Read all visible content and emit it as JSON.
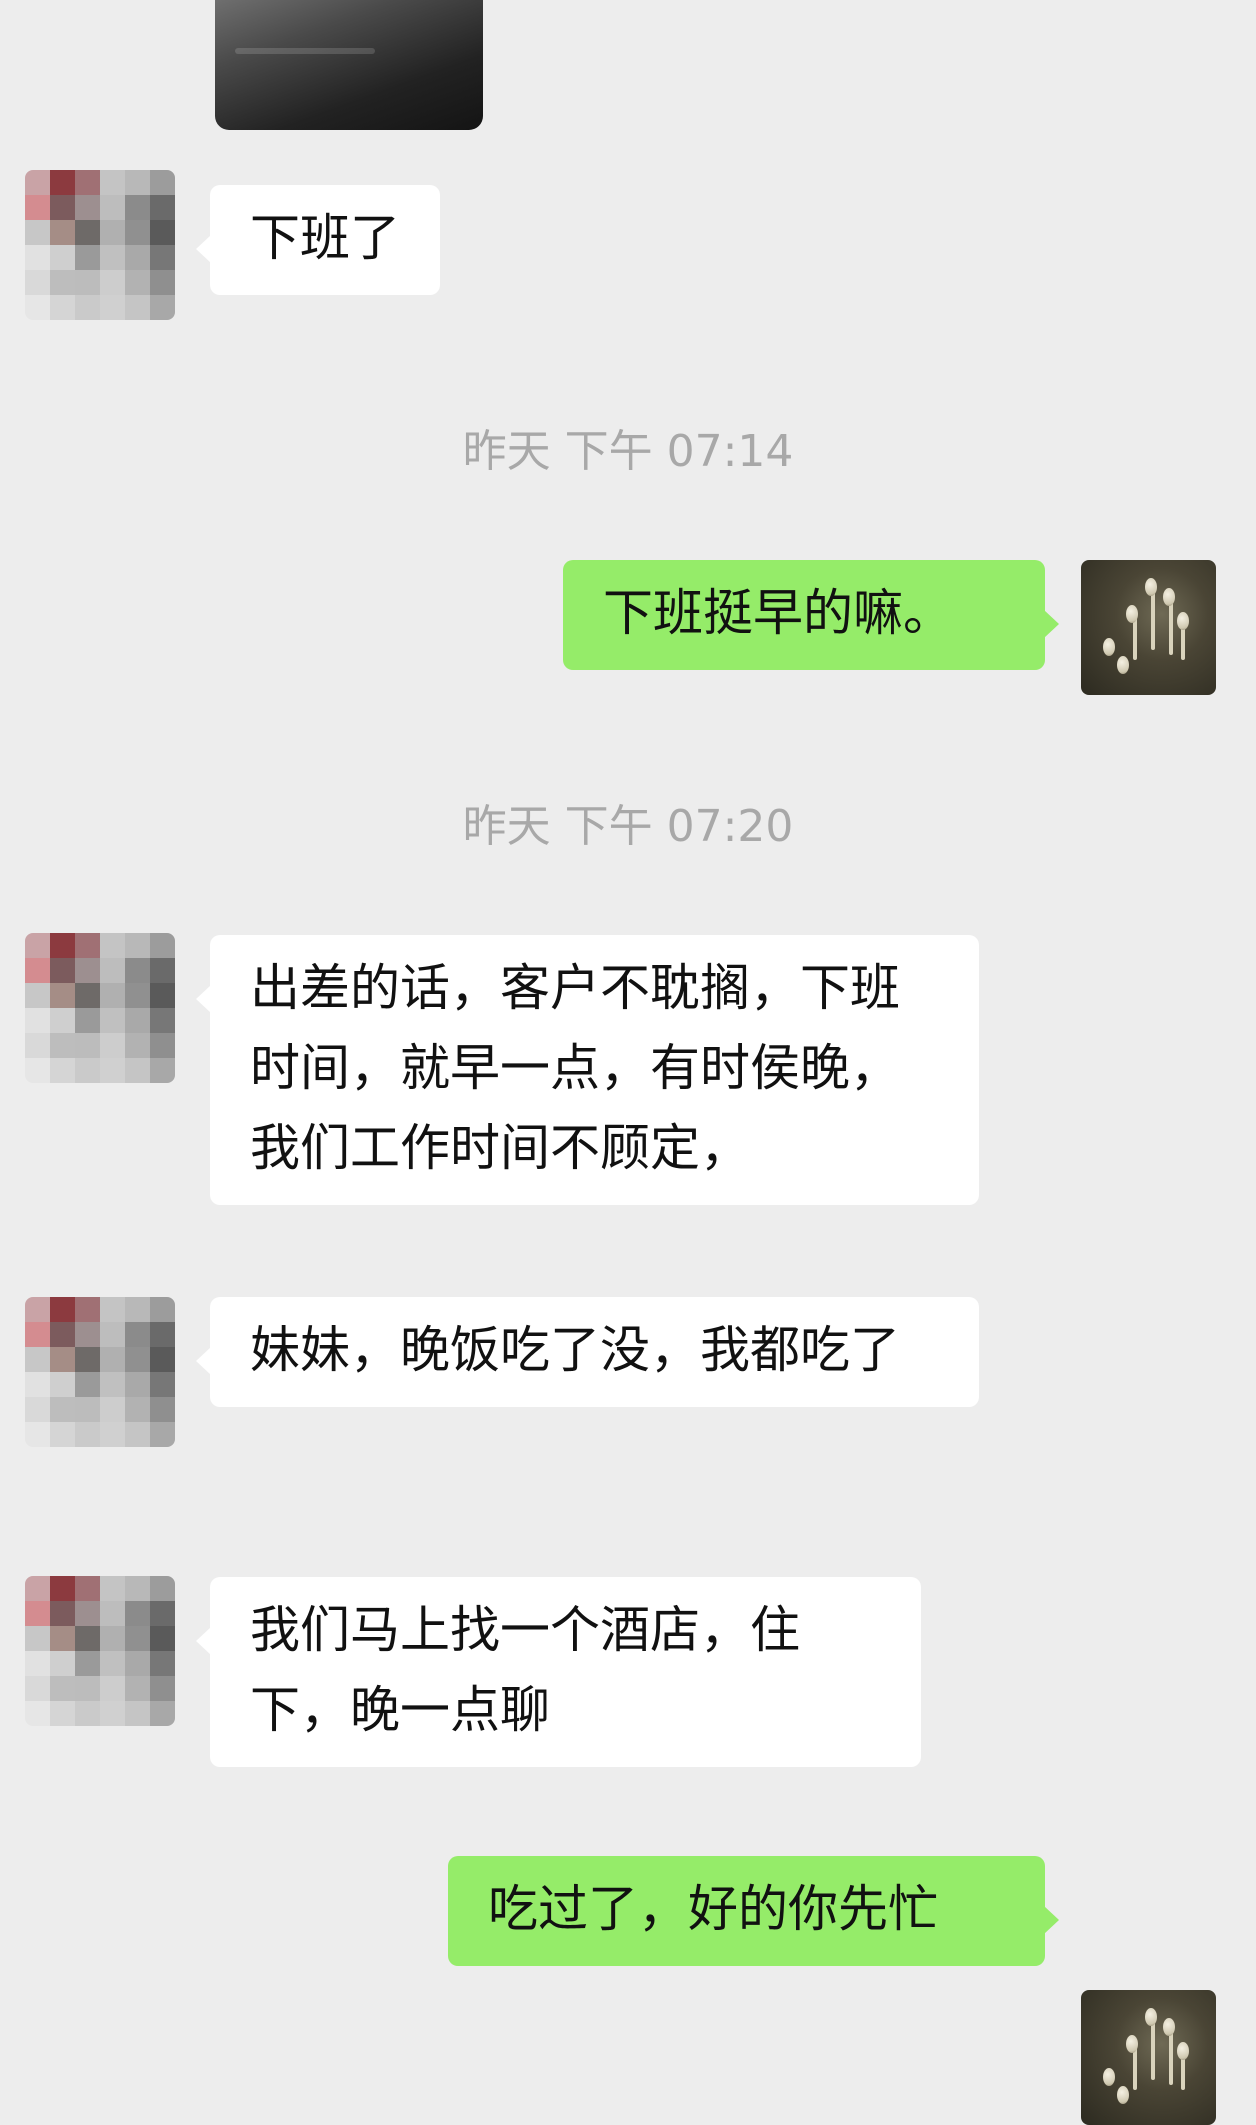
{
  "chat": {
    "messages": [
      {
        "text": "下班了"
      },
      {
        "text": "下班挺早的嘛。"
      },
      {
        "text": "出差的话，客户不耽搁，下班时间，就早一点，有时侯晚，我们工作时间不顾定，"
      },
      {
        "text": "妹妹，晚饭吃了没，我都吃了"
      },
      {
        "text": "我们马上找一个酒店，住下，晚一点聊"
      },
      {
        "text": "吃过了，好的你先忙"
      }
    ],
    "timestamps": [
      "昨天 下午 07:14",
      "昨天 下午 07:20"
    ]
  },
  "colors": {
    "background": "#ededed",
    "incoming_bubble": "#ffffff",
    "outgoing_bubble": "#95ec69",
    "timestamp_text": "#a8a8a8"
  },
  "icons": {
    "contact_avatar": "pixelated-avatar",
    "my_avatar": "sprout-photo-avatar"
  }
}
